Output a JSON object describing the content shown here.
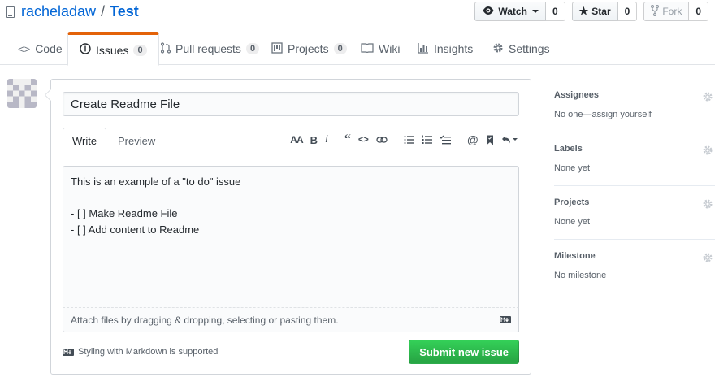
{
  "repo": {
    "owner": "racheladaw",
    "separator": "/",
    "name": "Test"
  },
  "actions": {
    "watch": {
      "label": "Watch",
      "count": "0"
    },
    "star": {
      "label": "Star",
      "count": "0"
    },
    "fork": {
      "label": "Fork",
      "count": "0"
    }
  },
  "nav": {
    "code": "Code",
    "issues": "Issues",
    "issues_count": "0",
    "pull_requests": "Pull requests",
    "pull_requests_count": "0",
    "projects": "Projects",
    "projects_count": "0",
    "wiki": "Wiki",
    "insights": "Insights",
    "settings": "Settings"
  },
  "form": {
    "title_value": "Create Readme File",
    "tab_write": "Write",
    "tab_preview": "Preview",
    "toolbar": {
      "header_icon": "text-size-icon",
      "bold": "B",
      "italic": "i"
    },
    "body_text": "This is an example of a \"to do\" issue\n\n- [ ] Make Readme File\n- [ ] Add content to Readme",
    "attach_text": "Attach files by dragging & dropping, selecting or pasting them.",
    "markdown_note": "Styling with Markdown is supported",
    "submit_label": "Submit new issue"
  },
  "sidebar": {
    "assignees": {
      "heading": "Assignees",
      "value": "No one—assign yourself"
    },
    "labels": {
      "heading": "Labels",
      "value": "None yet"
    },
    "projects": {
      "heading": "Projects",
      "value": "None yet"
    },
    "milestone": {
      "heading": "Milestone",
      "value": "No milestone"
    }
  },
  "colors": {
    "tab_accent": "#e36209",
    "primary_green": "#28a745",
    "link_blue": "#0366d6"
  }
}
